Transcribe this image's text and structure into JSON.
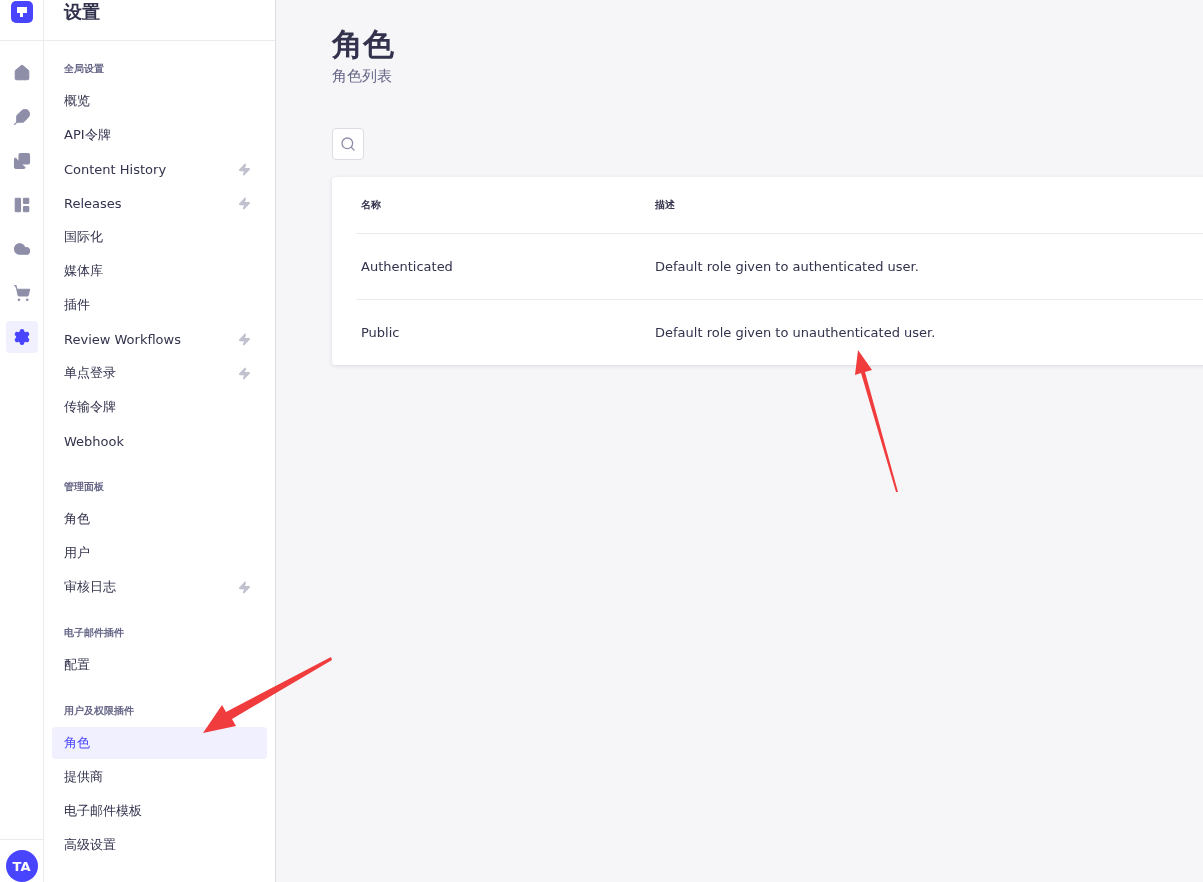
{
  "nav_rail": {
    "items": [
      {
        "selected": false
      },
      {
        "selected": false
      },
      {
        "selected": false
      },
      {
        "selected": false
      },
      {
        "selected": false
      },
      {
        "selected": false
      },
      {
        "selected": true
      }
    ],
    "avatar": "TA"
  },
  "sidebar": {
    "title": "设置",
    "sections": [
      {
        "title": "全局设置",
        "items": [
          {
            "label": "概览",
            "premium": false,
            "selected": false
          },
          {
            "label": "API令牌",
            "premium": false,
            "selected": false
          },
          {
            "label": "Content History",
            "premium": true,
            "selected": false
          },
          {
            "label": "Releases",
            "premium": true,
            "selected": false
          },
          {
            "label": "国际化",
            "premium": false,
            "selected": false
          },
          {
            "label": "媒体库",
            "premium": false,
            "selected": false
          },
          {
            "label": "插件",
            "premium": false,
            "selected": false
          },
          {
            "label": "Review Workflows",
            "premium": true,
            "selected": false
          },
          {
            "label": "单点登录",
            "premium": true,
            "selected": false
          },
          {
            "label": "传输令牌",
            "premium": false,
            "selected": false
          },
          {
            "label": "Webhook",
            "premium": false,
            "selected": false
          }
        ]
      },
      {
        "title": "管理面板",
        "items": [
          {
            "label": "角色",
            "premium": false,
            "selected": false
          },
          {
            "label": "用户",
            "premium": false,
            "selected": false
          },
          {
            "label": "审核日志",
            "premium": true,
            "selected": false
          }
        ]
      },
      {
        "title": "电子邮件插件",
        "items": [
          {
            "label": "配置",
            "premium": false,
            "selected": false
          }
        ]
      },
      {
        "title": "用户及权限插件",
        "items": [
          {
            "label": "角色",
            "premium": false,
            "selected": true
          },
          {
            "label": "提供商",
            "premium": false,
            "selected": false
          },
          {
            "label": "电子邮件模板",
            "premium": false,
            "selected": false
          },
          {
            "label": "高级设置",
            "premium": false,
            "selected": false
          }
        ]
      }
    ]
  },
  "page": {
    "title": "角色",
    "subtitle": "角色列表"
  },
  "table": {
    "columns": [
      "名称",
      "描述"
    ],
    "rows": [
      [
        "Authenticated",
        "Default role given to authenticated user."
      ],
      [
        "Public",
        "Default role given to unauthenticated user."
      ]
    ]
  }
}
